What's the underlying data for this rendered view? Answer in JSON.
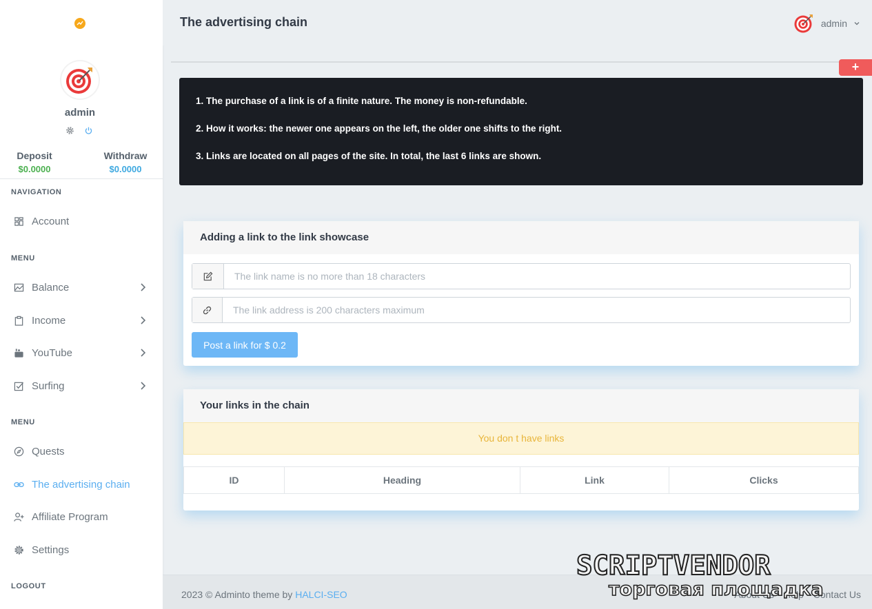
{
  "sidebar": {
    "username": "admin",
    "deposit": {
      "label": "Deposit",
      "value": "$0.0000"
    },
    "withdraw": {
      "label": "Withdraw",
      "value": "$0.0000"
    },
    "sections": {
      "navigation": "NAVIGATION",
      "menu1": "MENU",
      "menu2": "MENU",
      "logout": "LOGOUT"
    },
    "items": {
      "account": "Account",
      "balance": "Balance",
      "income": "Income",
      "youtube": "YouTube",
      "surfing": "Surfing",
      "quests": "Quests",
      "ad_chain": "The advertising chain",
      "affiliate": "Affiliate Program",
      "settings": "Settings"
    },
    "active_item": "The advertising chain"
  },
  "topbar": {
    "title": "The advertising chain",
    "user": "admin"
  },
  "plus_button": "+",
  "rules": [
    "1. The purchase of a link is of a finite nature. The money is non-refundable.",
    "2. How it works: the newer one appears on the left, the older one shifts to the right.",
    "3. Links are located on all pages of the site. In total, the last 6 links are shown."
  ],
  "add_link_card": {
    "title": "Adding a link to the link showcase",
    "name_value": "",
    "name_placeholder": "The link name is no more than 18 characters",
    "address_value": "",
    "address_placeholder": "The link address is 200 characters maximum",
    "submit_label": "Post a link for $ 0.2"
  },
  "links_card": {
    "title": "Your links in the chain",
    "empty_notice": "You don t have links",
    "columns": [
      "ID",
      "Heading",
      "Link",
      "Clicks"
    ]
  },
  "footer": {
    "copyright": "2023 © Adminto theme by ",
    "author": "HALCI-SEO",
    "links": [
      "About Us",
      "Help",
      "Contact Us"
    ]
  },
  "watermark": {
    "line1": "SCRIPTVENDOR",
    "line2": "торговая площадка"
  },
  "colors": {
    "accent": "#5aaef0",
    "deposit": "#4cb050",
    "withdraw": "#3fa9e0",
    "danger": "#f05b5b",
    "notice_text": "#e8b53a"
  }
}
